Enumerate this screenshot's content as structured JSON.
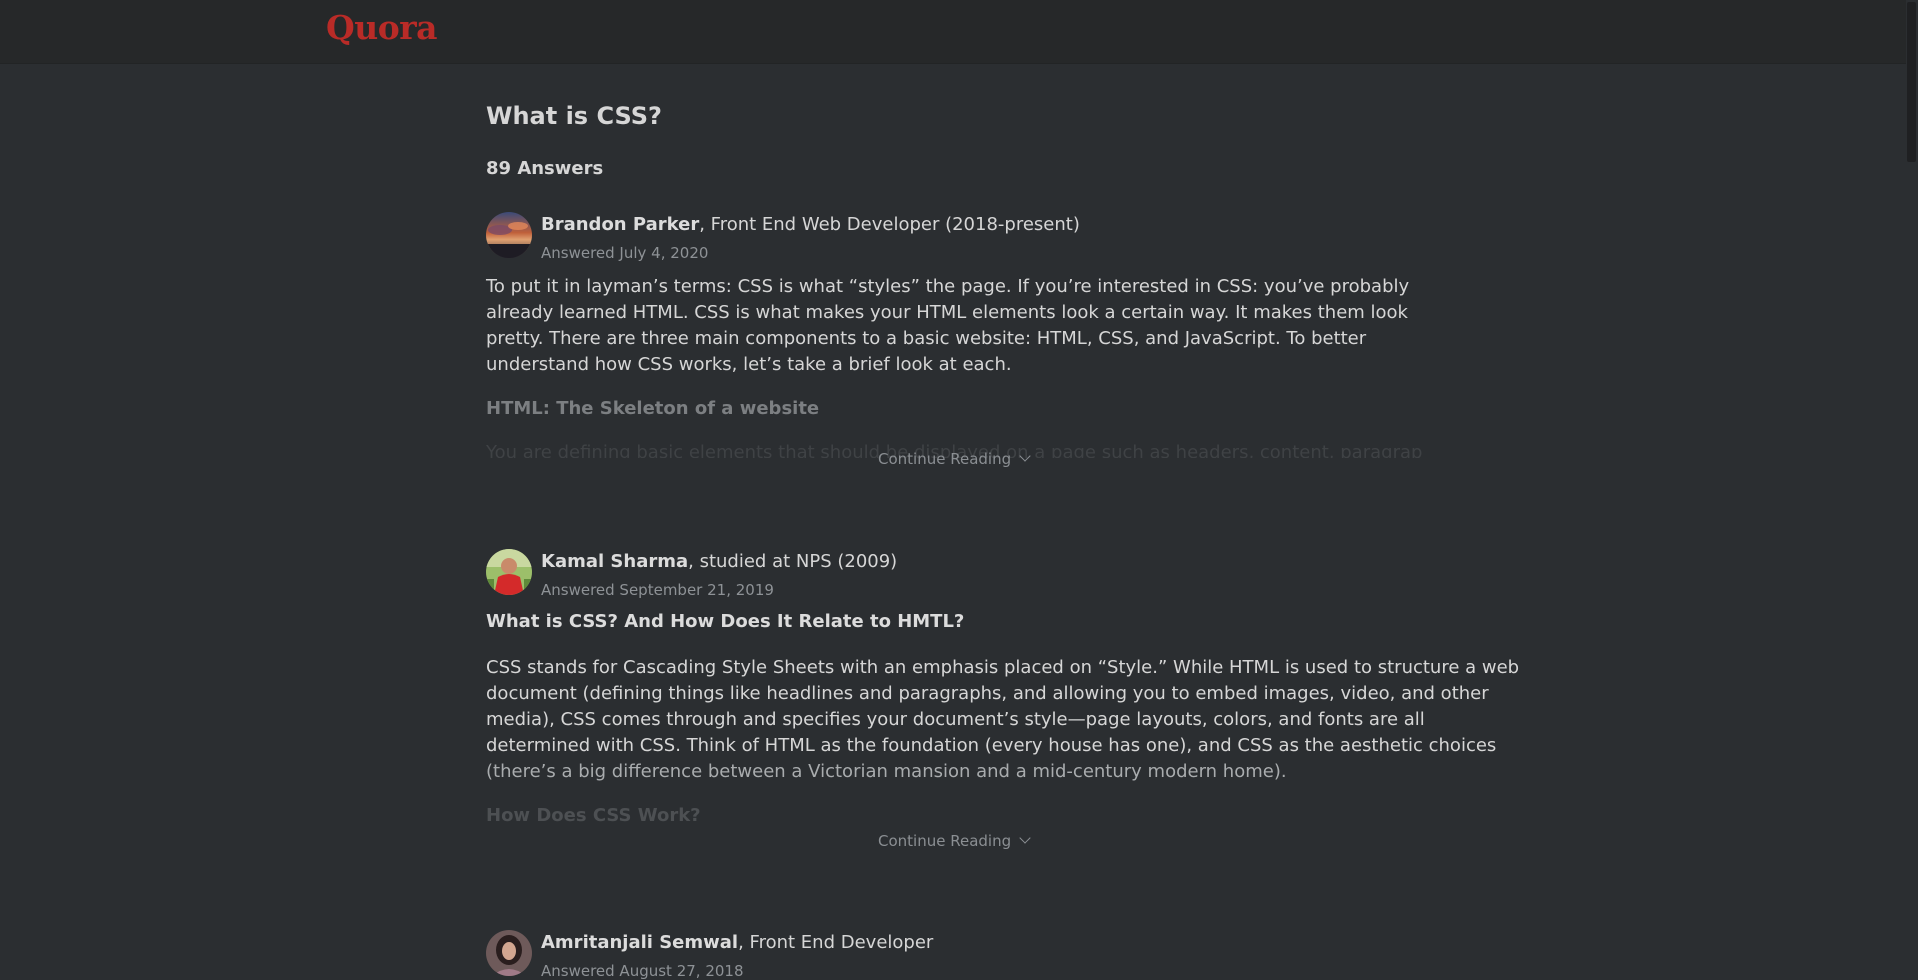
{
  "header": {
    "logo": "Quora"
  },
  "question": {
    "title": "What is CSS?",
    "answer_count": "89 Answers"
  },
  "answers": [
    {
      "author_name": "Brandon Parker",
      "credential": ", Front End Web Developer (2018-present)",
      "date": "Answered July 4, 2020",
      "body": "To put it in layman’s terms: CSS is what “styles” the page. If you’re interested in CSS: you’ve probably already learned HTML. CSS is what makes your HTML elements look a certain way. It makes them look pretty. There are three main components to a basic website: HTML, CSS, and JavaScript. To better understand how CSS works, let’s take a brief look at each.",
      "subheading": "HTML: The Skeleton of a website",
      "faded_text": "You are defining basic elements that should be displayed on a page such as headers, content, paragraphs and so",
      "continue_label": "Continue Reading"
    },
    {
      "author_name": "Kamal Sharma",
      "credential": ", studied at NPS (2009)",
      "date": "Answered September 21, 2019",
      "heading": "What is CSS? And How Does It Relate to HMTL?",
      "body_lines": [
        "CSS stands for Cascading Style Sheets with an emphasis placed on “Style.” While HTML is used to structure a web",
        "document (defining things like headlines and paragraphs, and allowing you to embed images, video, and other",
        "media), CSS comes through and specifies your document’s style—page layouts, colors, and fonts are all",
        "determined with CSS. Think of HTML as the foundation (every house has one), and CSS as the aesthetic choices",
        "(there’s a big difference between a Victorian mansion and a mid-century modern home)."
      ],
      "subheading": "How Does CSS Work?",
      "continue_label": "Continue Reading"
    },
    {
      "author_name": "Amritanjali Semwal",
      "credential": ", Front End Developer",
      "date": "Answered August 27, 2018"
    }
  ]
}
